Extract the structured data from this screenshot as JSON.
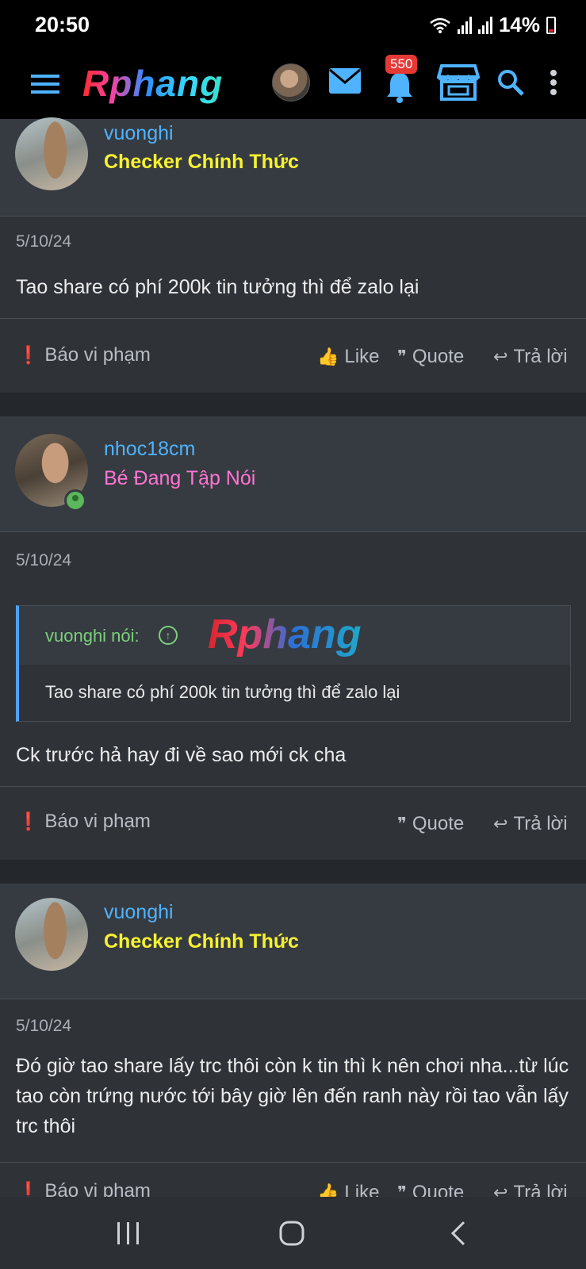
{
  "status": {
    "time": "20:50",
    "battery": "14%"
  },
  "header": {
    "logo": "Rphang",
    "notification_count": "550"
  },
  "posts": [
    {
      "username": "vuonghi",
      "user_title": "Checker Chính Thức",
      "date": "5/10/24",
      "message": "Tao share có phí 200k tin tưởng thì để zalo lại",
      "actions": {
        "report": "Báo vi phạm",
        "like": "Like",
        "quote": "Quote",
        "reply": "Trả lời"
      }
    },
    {
      "username": "nhoc18cm",
      "user_title": "Bé Đang Tập Nói",
      "date": "5/10/24",
      "quote": {
        "author": "vuonghi nói:",
        "logo": "Rphang",
        "text": "Tao share có phí 200k tin tưởng thì để zalo lại"
      },
      "message": "Ck trước hả hay đi về sao mới ck cha",
      "actions": {
        "report": "Báo vi phạm",
        "quote": "Quote",
        "reply": "Trả lời"
      }
    },
    {
      "username": "vuonghi",
      "user_title": "Checker Chính Thức",
      "date": "5/10/24",
      "message": "Đó giờ tao share lấy trc thôi còn k tin thì k nên chơi nha...từ lúc tao còn trứng nước tới bây giờ lên đến ranh này rồi tao vẫn lấy trc thôi",
      "actions": {
        "report": "Báo vi phạm",
        "like": "Like",
        "quote": "Quote",
        "reply": "Trả lời"
      }
    }
  ]
}
